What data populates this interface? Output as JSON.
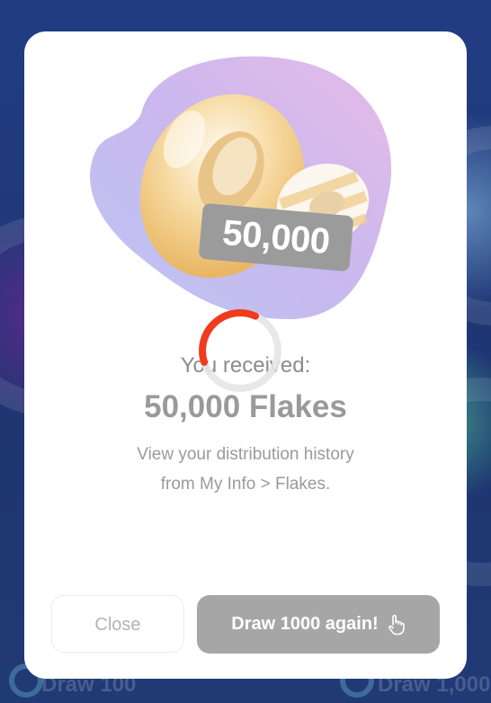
{
  "background": {
    "left_label": "Draw 100",
    "right_label": "Draw 1,000"
  },
  "dialog": {
    "badge_amount": "50,000",
    "received_label": "You received:",
    "amount_label": "50,000 Flakes",
    "description_line1": "View your distribution history",
    "description_line2": "from My Info > Flakes.",
    "close_label": "Close",
    "draw_again_label": "Draw 1000 again!",
    "draw_again_icon": "pointer-hand-icon",
    "loading_icon": "loading-spinner-icon"
  },
  "colors": {
    "accent_spinner": "#f03b1e",
    "button_disabled": "#a6a6a6",
    "blob_purple": "#c9b6ef",
    "blob_pink": "#e6b9e6"
  }
}
